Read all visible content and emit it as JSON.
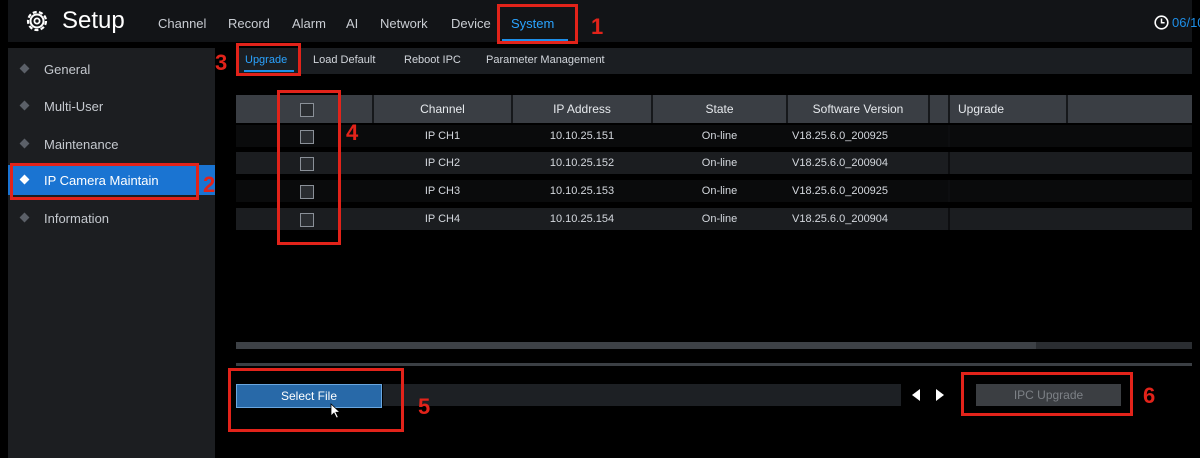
{
  "header": {
    "title": "Setup",
    "date": "06/10",
    "tabs": [
      {
        "label": "Channel"
      },
      {
        "label": "Record"
      },
      {
        "label": "Alarm"
      },
      {
        "label": "AI"
      },
      {
        "label": "Network"
      },
      {
        "label": "Device"
      },
      {
        "label": "System",
        "active": true
      }
    ]
  },
  "sidebar": {
    "items": [
      {
        "label": "General"
      },
      {
        "label": "Multi-User"
      },
      {
        "label": "Maintenance"
      },
      {
        "label": "IP Camera Maintain",
        "active": true
      },
      {
        "label": "Information"
      }
    ]
  },
  "subtabs": [
    {
      "label": "Upgrade",
      "active": true
    },
    {
      "label": "Load Default"
    },
    {
      "label": "Reboot IPC"
    },
    {
      "label": "Parameter Management"
    }
  ],
  "table": {
    "columns": [
      "Channel",
      "IP Address",
      "State",
      "Software Version",
      "Upgrade"
    ],
    "rows": [
      {
        "channel": "IP CH1",
        "ip": "10.10.25.151",
        "state": "On-line",
        "version": "V18.25.6.0_200925",
        "upgrade": ""
      },
      {
        "channel": "IP CH2",
        "ip": "10.10.25.152",
        "state": "On-line",
        "version": "V18.25.6.0_200904",
        "upgrade": ""
      },
      {
        "channel": "IP CH3",
        "ip": "10.10.25.153",
        "state": "On-line",
        "version": "V18.25.6.0_200925",
        "upgrade": ""
      },
      {
        "channel": "IP CH4",
        "ip": "10.10.25.154",
        "state": "On-line",
        "version": "V18.25.6.0_200904",
        "upgrade": ""
      }
    ]
  },
  "buttons": {
    "select_file": "Select File",
    "ipc_upgrade": "IPC Upgrade"
  },
  "annotations": [
    "1",
    "2",
    "3",
    "4",
    "5",
    "6"
  ],
  "colors": {
    "accent": "#1e8fe8",
    "annotation": "#e2231a",
    "sidebar_active": "#1a74d2"
  },
  "icons": {
    "settings": "gear-icon",
    "clock": "clock-icon",
    "prev": "triangle-left-icon",
    "next": "triangle-right-icon",
    "cursor": "mouse-pointer-icon"
  }
}
